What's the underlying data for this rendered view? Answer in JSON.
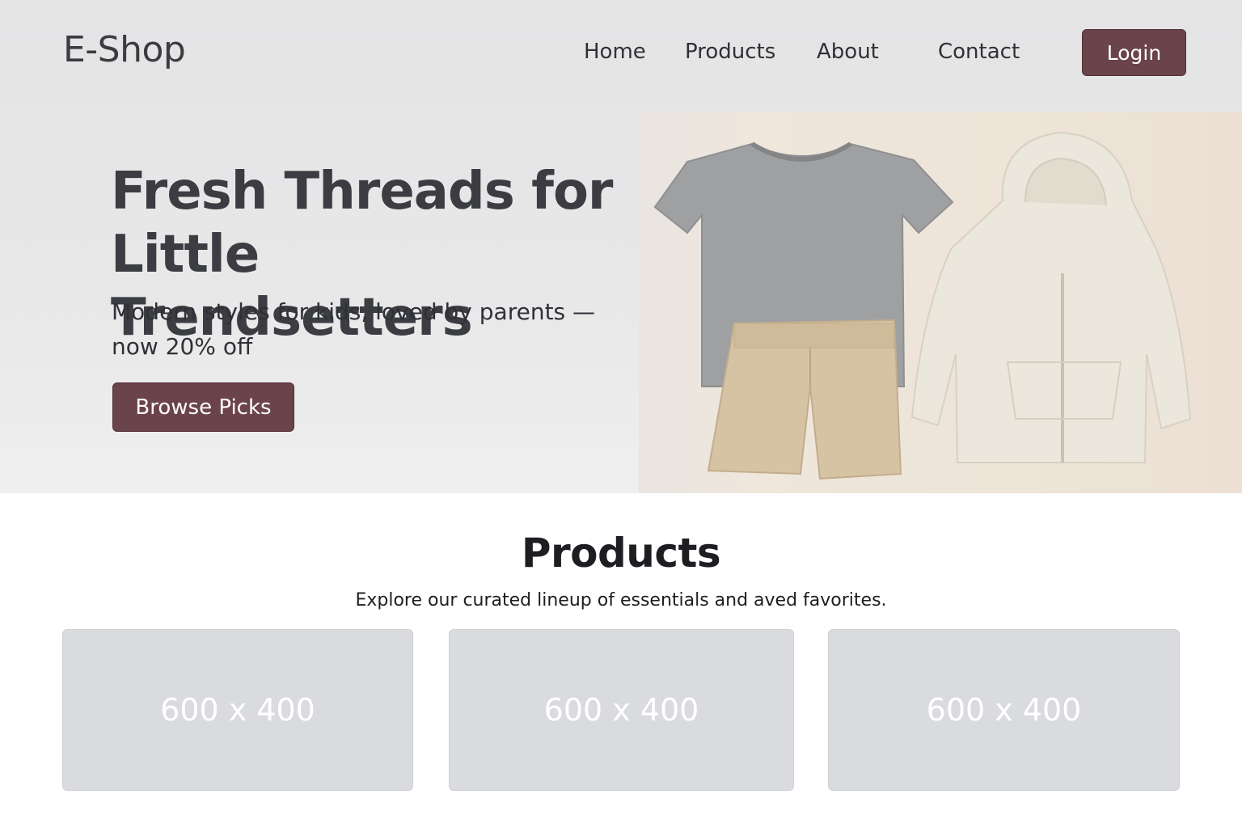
{
  "brand": "E-Shop",
  "nav": {
    "links": [
      "Home",
      "Products",
      "About",
      "Contact"
    ],
    "login_label": "Login"
  },
  "hero": {
    "title_line1": "Fresh Threads for",
    "title_line2": "Little Trendsetters",
    "subtitle": "Modern styles for kids, loved by parents — now 20% off",
    "cta_label": "Browse Picks",
    "image_alt": "gray kids t-shirt, beige shorts and cream zip hoodie"
  },
  "products": {
    "title": "Products",
    "subtitle": "Explore our curated lineup of essentials and aved favorites.",
    "cards": [
      {
        "label": "600 x 400"
      },
      {
        "label": "600 x 400"
      },
      {
        "label": "600 x 400"
      }
    ]
  },
  "colors": {
    "accent": "#6b434a",
    "placeholder": "#dadbde",
    "text": "#2f3136"
  }
}
